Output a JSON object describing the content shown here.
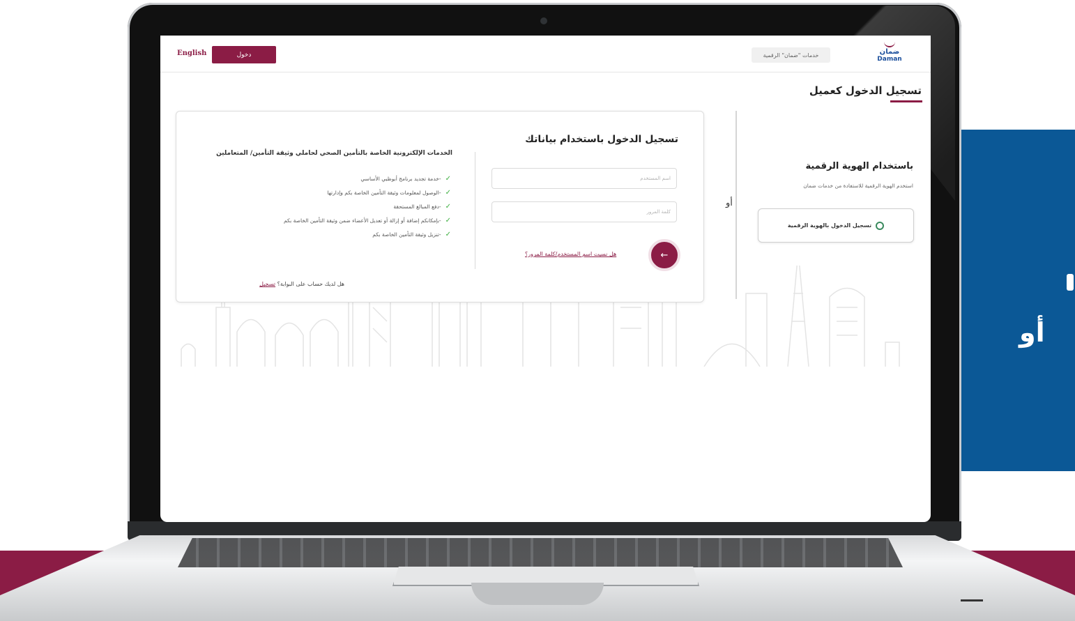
{
  "header": {
    "language_label": "English",
    "login_label": "دخول",
    "digital_services_label": "خدمات \"ضمان\" الرقمية",
    "logo_ar": "ضمان",
    "logo_en": "Daman"
  },
  "page": {
    "title": "تسجيل الدخول كعميل"
  },
  "credentials_panel": {
    "title": "تسجيل الدخول باستخدام بياناتك",
    "username_placeholder": "اسم المستخدم",
    "password_placeholder": "كلمة المرور",
    "forgot_link": "هل نسيت اسم المستخدم/كلمة المرور؟",
    "submit_icon": "arrow-left-icon"
  },
  "services": {
    "title": "الخدمات الإلكترونية الخاصة بالتأمين الصحي لحاملي وثيقة التأمين/ المتعاملين",
    "items": [
      "-خدمة تجديد برنامج أبوظبي الأساسي",
      "-الوصول لمعلومات وثيقة التأمين الخاصة بكم وإدارتها",
      "-دفع المبالغ المستحقة",
      "-بإمكانكم إضافة أو إزالة أو تعديل الأعضاء ضمن وثيقة التأمين الخاصة بكم",
      "-تنزيل وثيقة التأمين الخاصة بكم"
    ],
    "register_prompt": "هل لديك حساب على البوابة؟",
    "register_link": "تسجيل"
  },
  "separator": {
    "or_label": "أو"
  },
  "digital_id_panel": {
    "title": "باستخدام الهوية الرقمية",
    "subtitle": "استخدم الهوية الرقمية للاستفادة من خدمات ضمان",
    "button_label": "تسجيل الدخول بالهوية الرقمية",
    "button_icon": "fingerprint-icon"
  },
  "background": {
    "side_text": "أو"
  },
  "colors": {
    "brand_maroon": "#8b1c45",
    "side_blue": "#0b5896",
    "check_green": "#3cae3f"
  }
}
